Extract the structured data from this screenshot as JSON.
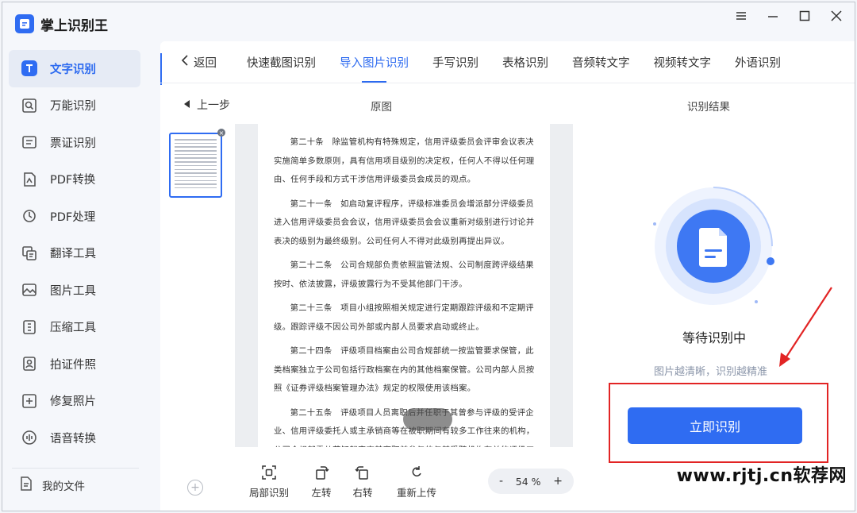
{
  "app": {
    "title": "掌上识别王"
  },
  "sidebar": {
    "items": [
      {
        "label": "文字识别",
        "icon": "text-recognition-icon",
        "active": true
      },
      {
        "label": "万能识别",
        "icon": "universal-scan-icon"
      },
      {
        "label": "票证识别",
        "icon": "ticket-icon"
      },
      {
        "label": "PDF转换",
        "icon": "pdf-convert-icon"
      },
      {
        "label": "PDF处理",
        "icon": "pdf-process-icon"
      },
      {
        "label": "翻译工具",
        "icon": "translate-icon"
      },
      {
        "label": "图片工具",
        "icon": "image-tool-icon"
      },
      {
        "label": "压缩工具",
        "icon": "compress-icon"
      },
      {
        "label": "拍证件照",
        "icon": "id-photo-icon"
      },
      {
        "label": "修复照片",
        "icon": "repair-photo-icon"
      },
      {
        "label": "语音转换",
        "icon": "voice-convert-icon"
      }
    ],
    "my_files": "我的文件"
  },
  "window_controls": [
    "menu-icon",
    "minimize-icon",
    "maximize-icon",
    "close-icon"
  ],
  "tabs": {
    "back": "返回",
    "items": [
      {
        "label": "快速截图识别"
      },
      {
        "label": "导入图片识别",
        "active": true
      },
      {
        "label": "手写识别"
      },
      {
        "label": "表格识别"
      },
      {
        "label": "音频转文字"
      },
      {
        "label": "视频转文字"
      },
      {
        "label": "外语识别"
      }
    ]
  },
  "workspace": {
    "prev_step": "上一步",
    "original_label": "原图",
    "result_label": "识别结果"
  },
  "document": {
    "paragraphs": [
      "第二十条　除监管机构有特殊规定，信用评级委员会评审会议表决实施简单多数原则，具有信用项目级别的决定权，任何人不得以任何理由、任何手段和方式干涉信用评级委员会成员的观点。",
      "第二十一条　如启动复评程序，评级标准委员会增派部分评级委员进入信用评级委员会会议，信用评级委员会会议重新对级别进行讨论并表决的级别为最终级别。公司任何人不得对此级别再提出异议。",
      "第二十二条　公司合规部负责依照监管法规、公司制度跨评级结果按时、依法披露，评级披露行为不受其他部门干涉。",
      "第二十三条　项目小组按照相关规定进行定期跟踪评级和不定期评级。跟踪评级不因公司外部或内部人员要求启动或终止。",
      "第二十四条　评级项目档案由公司合规部统一按监管要求保管，此类档案独立于公司包括行政档案在内的其他档案保管。公司内部人员按照《证券评级档案管理办法》规定的权限使用该档案。",
      "第二十五条　评级项目人员离职后并任职于其曾参与评级的受评企业、信用评级委托人或主承销商等在被职期间有较多工作往来的机构，公司合规部需从获知起审查其离职前参与的与其受聘机构有关的评级工作，若存在利益冲突，则及时披露审查结果。"
    ]
  },
  "tools": [
    {
      "label": "局部识别",
      "icon": "partial-recognize-icon"
    },
    {
      "label": "左转",
      "icon": "rotate-left-icon"
    },
    {
      "label": "右转",
      "icon": "rotate-right-icon"
    },
    {
      "label": "重新上传",
      "icon": "reupload-icon"
    }
  ],
  "zoom": {
    "minus": "-",
    "value": "54 %",
    "plus": "+"
  },
  "result": {
    "status": "等待识别中",
    "hint": "图片越清晰，识别越精准",
    "button": "立即识别"
  },
  "watermark": "www.rjtj.cn软荐网",
  "colors": {
    "accent": "#2f6cf2",
    "highlight_box": "#e22424"
  }
}
